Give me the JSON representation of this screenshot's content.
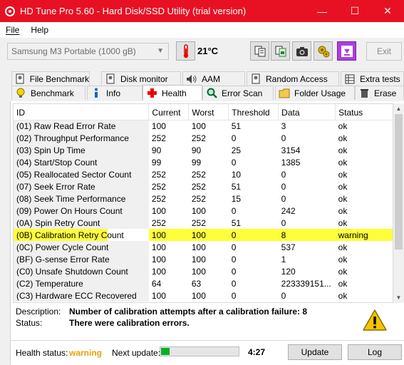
{
  "window": {
    "title": "HD Tune Pro 5.60 - Hard Disk/SSD Utility (trial version)",
    "controls": {
      "minimize": "—",
      "maximize": "☐",
      "close": "✕"
    },
    "accent_color": "#e81123"
  },
  "menu": {
    "file": "File",
    "help": "Help"
  },
  "toolbar": {
    "drive": "Samsung M3 Portable (1000 gB)",
    "temperature": "21°C",
    "exit_label": "Exit",
    "icons": [
      "thermometer-icon",
      "copy-info-icon",
      "copy-screenshot-icon",
      "camera-icon",
      "options-icon",
      "save-icon"
    ]
  },
  "tabs_top": [
    "File Benchmark",
    "Disk monitor",
    "AAM",
    "Random Access",
    "Extra tests"
  ],
  "tabs_bottom": [
    "Benchmark",
    "Info",
    "Health",
    "Error Scan",
    "Folder Usage",
    "Erase"
  ],
  "active_tab": "Health",
  "table": {
    "headers": [
      "ID",
      "Current",
      "Worst",
      "Threshold",
      "Data",
      "Status"
    ],
    "rows": [
      [
        "(01) Raw Read Error Rate",
        "100",
        "100",
        "51",
        "3",
        "ok"
      ],
      [
        "(02) Throughput Performance",
        "252",
        "252",
        "0",
        "0",
        "ok"
      ],
      [
        "(03) Spin Up Time",
        "90",
        "90",
        "25",
        "3154",
        "ok"
      ],
      [
        "(04) Start/Stop Count",
        "99",
        "99",
        "0",
        "1385",
        "ok"
      ],
      [
        "(05) Reallocated Sector Count",
        "252",
        "252",
        "10",
        "0",
        "ok"
      ],
      [
        "(07) Seek Error Rate",
        "252",
        "252",
        "51",
        "0",
        "ok"
      ],
      [
        "(08) Seek Time Performance",
        "252",
        "252",
        "15",
        "0",
        "ok"
      ],
      [
        "(09) Power On Hours Count",
        "100",
        "100",
        "0",
        "242",
        "ok"
      ],
      [
        "(0A) Spin Retry Count",
        "252",
        "252",
        "51",
        "0",
        "ok"
      ],
      [
        "(0B) Calibration Retry Count",
        "100",
        "100",
        "0",
        "8",
        "warning"
      ],
      [
        "(0C) Power Cycle Count",
        "100",
        "100",
        "0",
        "537",
        "ok"
      ],
      [
        "(BF) G-sense Error Rate",
        "100",
        "100",
        "0",
        "1",
        "ok"
      ],
      [
        "(C0) Unsafe Shutdown Count",
        "100",
        "100",
        "0",
        "120",
        "ok"
      ],
      [
        "(C2) Temperature",
        "64",
        "63",
        "0",
        "223339151...",
        "ok"
      ],
      [
        "(C3) Hardware ECC Recovered",
        "100",
        "100",
        "0",
        "0",
        "ok"
      ]
    ],
    "highlight_row": 9,
    "highlight_color": "#fffe3a"
  },
  "details": {
    "description_label": "Description:",
    "description": "Number of calibration attempts after a calibration failure: 8",
    "status_label": "Status:",
    "status": "There were calibration errors."
  },
  "footer": {
    "health_label": "Health status:",
    "health_value": "warning",
    "health_color": "#e6a100",
    "next_update_label": "Next update:",
    "progress_fraction": 0.11,
    "countdown": "4:27",
    "update_label": "Update",
    "log_label": "Log"
  }
}
